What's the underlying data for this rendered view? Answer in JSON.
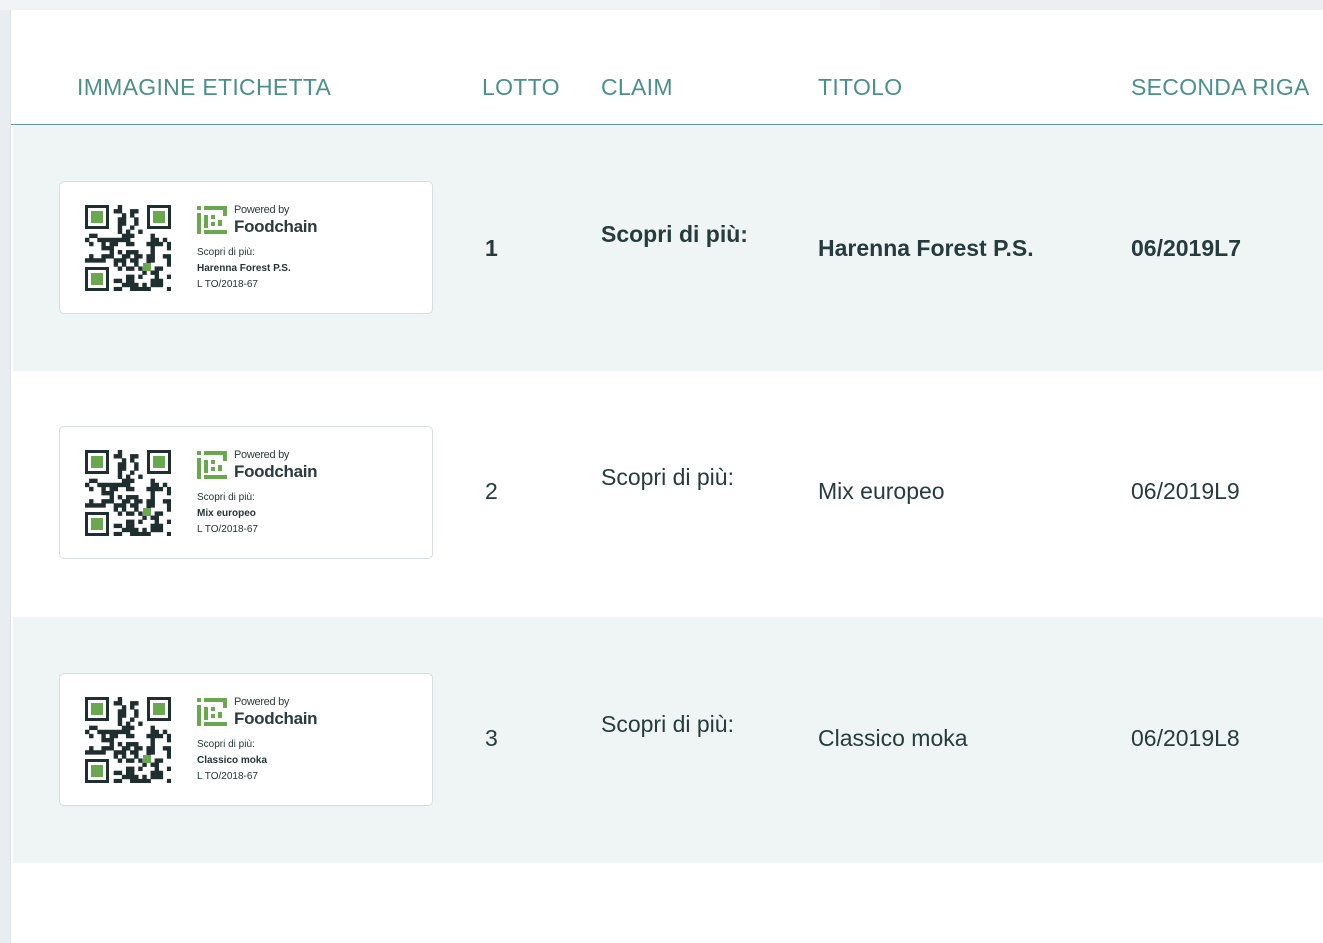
{
  "table": {
    "headers": {
      "image": "IMMAGINE ETICHETTA",
      "lot": "LOTTO",
      "claim": "CLAIM",
      "title": "TITOLO",
      "second_line": "SECONDA RIGA"
    },
    "rows": [
      {
        "lot": "1",
        "claim": "Scopri di più:",
        "title": "Harenna Forest P.S.",
        "second_line": "06/2019L7",
        "bold": true,
        "label": {
          "powered": "Powered by",
          "brand": "Foodchain",
          "claim": "Scopri di più:",
          "name": "Harenna Forest P.S.",
          "lot": "L TO/2018-67"
        }
      },
      {
        "lot": "2",
        "claim": "Scopri di più:",
        "title": "Mix europeo",
        "second_line": "06/2019L9",
        "bold": false,
        "label": {
          "powered": "Powered by",
          "brand": "Foodchain",
          "claim": "Scopri di più:",
          "name": "Mix europeo",
          "lot": "L TO/2018-67"
        }
      },
      {
        "lot": "3",
        "claim": "Scopri di più:",
        "title": "Classico moka",
        "second_line": "06/2019L8",
        "bold": false,
        "label": {
          "powered": "Powered by",
          "brand": "Foodchain",
          "claim": "Scopri di più:",
          "name": "Classico moka",
          "lot": "L TO/2018-67"
        }
      }
    ]
  },
  "colors": {
    "header_text": "#4b8f8c",
    "row_shade": "#eff4f4",
    "body_text": "#253b3d",
    "brand_green": "#6aa84f"
  },
  "icons": {
    "qr": "qr-code-icon",
    "logo": "foodchain-logo-icon"
  }
}
